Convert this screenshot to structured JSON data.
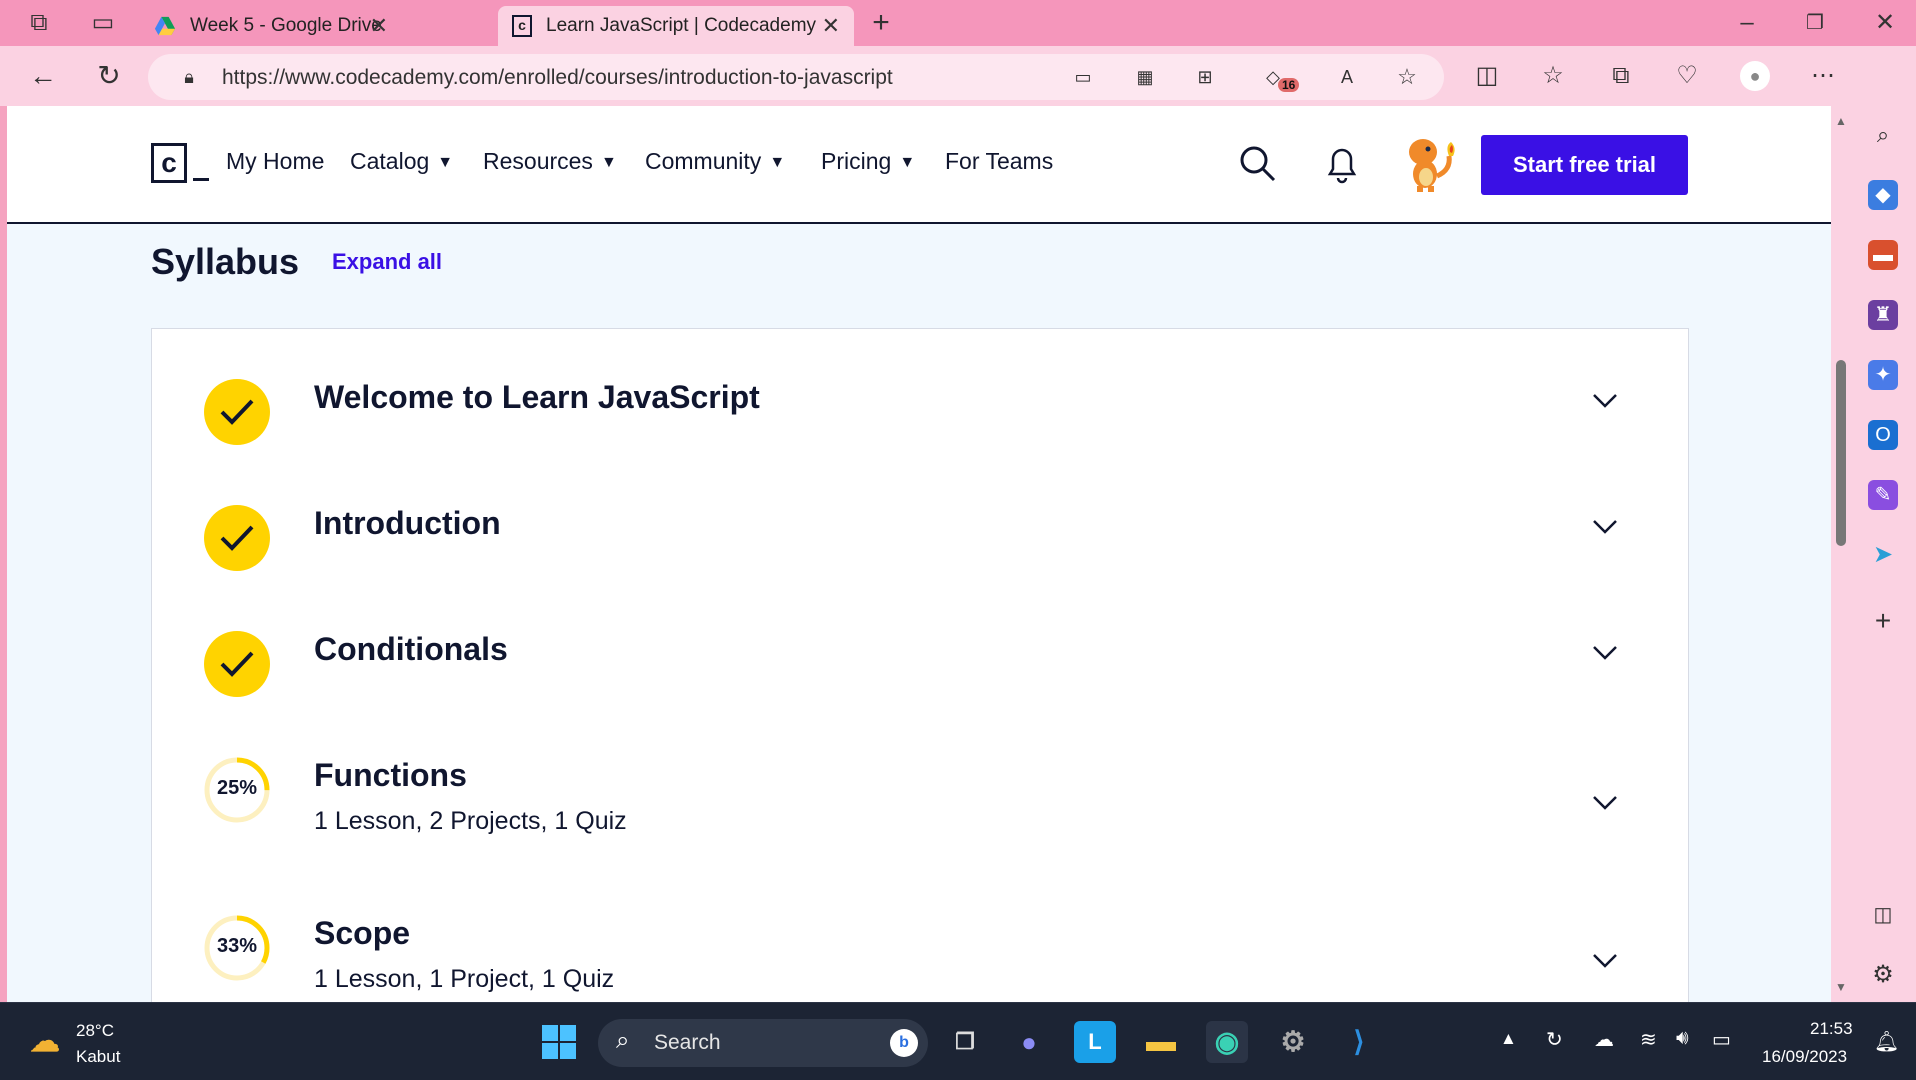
{
  "browser": {
    "tabs": [
      {
        "title": "Week 5 - Google Drive",
        "active": false
      },
      {
        "title": "Learn JavaScript | Codecademy",
        "active": true
      }
    ],
    "url": "https://www.codecademy.com/enrolled/courses/introduction-to-javascript",
    "badge_count": "16"
  },
  "nav": {
    "logo": "c",
    "items": [
      {
        "label": "My Home",
        "dropdown": false
      },
      {
        "label": "Catalog",
        "dropdown": true
      },
      {
        "label": "Resources",
        "dropdown": true
      },
      {
        "label": "Community",
        "dropdown": true
      },
      {
        "label": "Pricing",
        "dropdown": true
      },
      {
        "label": "For Teams",
        "dropdown": false
      }
    ],
    "cta": "Start free trial"
  },
  "syllabus": {
    "title": "Syllabus",
    "expand_label": "Expand all",
    "modules": [
      {
        "title": "Welcome to Learn JavaScript",
        "status": "complete",
        "progress": null,
        "details": ""
      },
      {
        "title": "Introduction",
        "status": "complete",
        "progress": null,
        "details": ""
      },
      {
        "title": "Conditionals",
        "status": "complete",
        "progress": null,
        "details": ""
      },
      {
        "title": "Functions",
        "status": "in-progress",
        "progress": "25%",
        "progress_value": 0.25,
        "details": "1 Lesson, 2 Projects, 1 Quiz"
      },
      {
        "title": "Scope",
        "status": "in-progress",
        "progress": "33%",
        "progress_value": 0.33,
        "details": "1 Lesson, 1 Project, 1 Quiz"
      }
    ]
  },
  "taskbar": {
    "weather_temp": "28°C",
    "weather_desc": "Kabut",
    "search_placeholder": "Search",
    "time": "21:53",
    "date": "16/09/2023"
  },
  "colors": {
    "accent": "#3a10e5",
    "complete": "#ffd300",
    "navy": "#10162f",
    "chrome_pink": "#f596bb"
  }
}
